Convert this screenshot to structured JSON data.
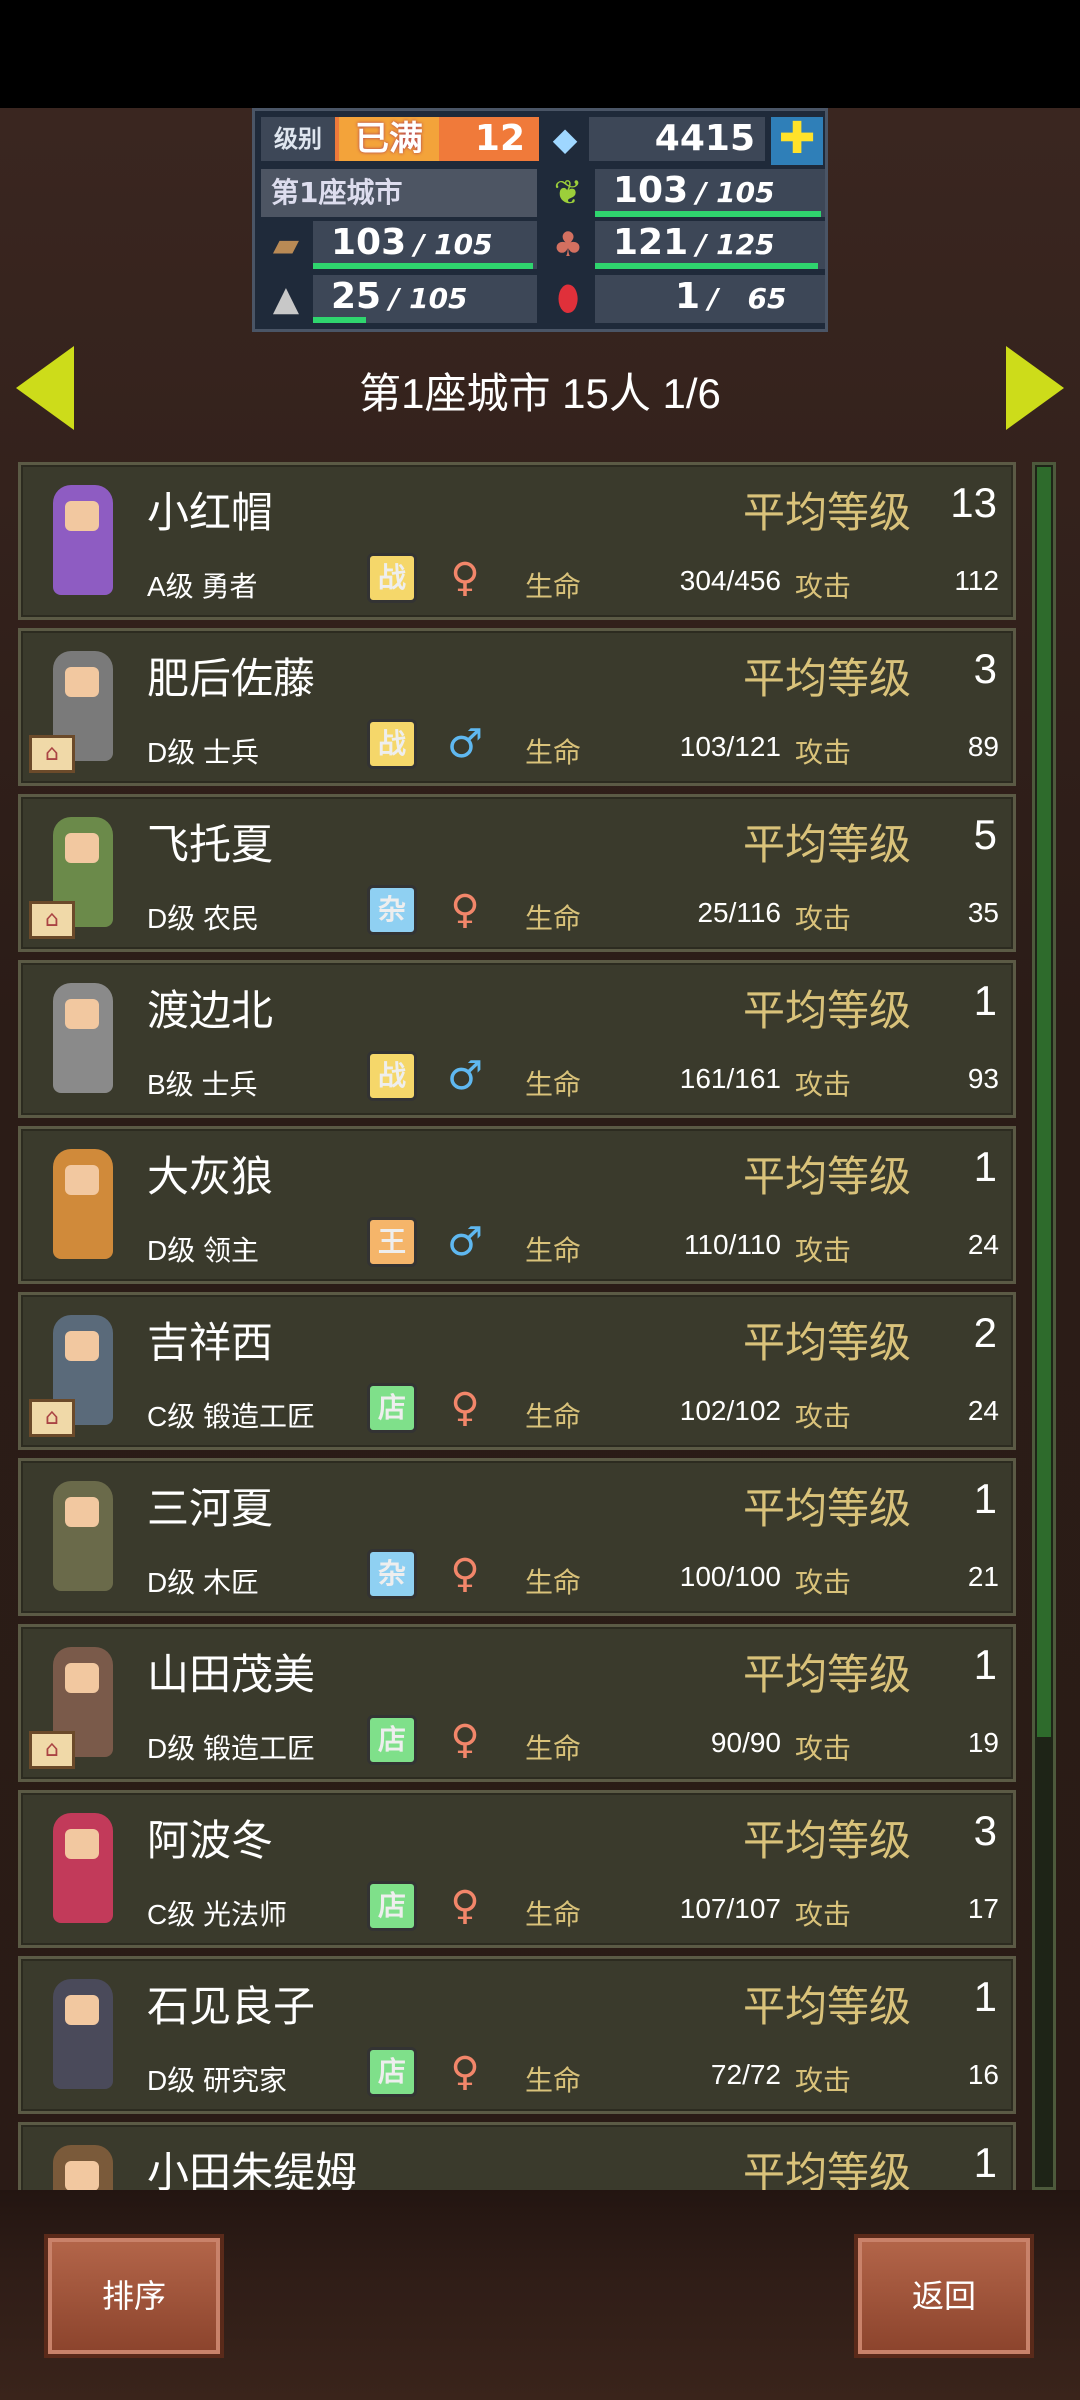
{
  "resources": {
    "level_label": "级别",
    "max_label": "已满",
    "level": "12",
    "gems": "4415",
    "plus_icon": "plus-icon",
    "city_name": "第1座城市",
    "food_current": "103",
    "food_max": "105",
    "wood_current": "103",
    "wood_max": "105",
    "supplies_current": "121",
    "supplies_max": "125",
    "ore_current": "25",
    "ore_max": "105",
    "ruby_current": "1",
    "ruby_max": "65",
    "slash": "/",
    "bars": {
      "food": 0.981,
      "wood": 0.981,
      "supplies": 0.968,
      "ore": 0.238
    }
  },
  "header": {
    "title": "第1座城市  15人 1/6"
  },
  "labels": {
    "avg_level": "平均等级",
    "hp": "生命",
    "attack": "攻击"
  },
  "residents": [
    {
      "name": "小红帽",
      "avg_level": "13",
      "class": "A级 勇者",
      "job": "战",
      "job_color": "#f5d76a",
      "sex": "♀",
      "sex_color": "#f2866a",
      "hp": "304/456",
      "attack": "112",
      "body_color": "#8e5cc2",
      "house": false
    },
    {
      "name": "肥后佐藤",
      "avg_level": "3",
      "class": "D级 士兵",
      "job": "战",
      "job_color": "#f5d76a",
      "sex": "♂",
      "sex_color": "#5fb8f0",
      "hp": "103/121",
      "attack": "89",
      "body_color": "#7a7a7a",
      "house": true
    },
    {
      "name": "飞托夏",
      "avg_level": "5",
      "class": "D级 农民",
      "job": "杂",
      "job_color": "#8fd0f2",
      "sex": "♀",
      "sex_color": "#f2866a",
      "hp": "25/116",
      "attack": "35",
      "body_color": "#6b8a4a",
      "house": true
    },
    {
      "name": "渡边北",
      "avg_level": "1",
      "class": "B级 士兵",
      "job": "战",
      "job_color": "#f5d76a",
      "sex": "♂",
      "sex_color": "#5fb8f0",
      "hp": "161/161",
      "attack": "93",
      "body_color": "#8a8a8a",
      "house": false
    },
    {
      "name": "大灰狼",
      "avg_level": "1",
      "class": "D级 领主",
      "job": "王",
      "job_color": "#f5b56a",
      "sex": "♂",
      "sex_color": "#5fb8f0",
      "hp": "110/110",
      "attack": "24",
      "body_color": "#d08a3a",
      "house": false
    },
    {
      "name": "吉祥西",
      "avg_level": "2",
      "class": "C级 锻造工匠",
      "job": "店",
      "job_color": "#7fe08a",
      "sex": "♀",
      "sex_color": "#f2866a",
      "hp": "102/102",
      "attack": "24",
      "body_color": "#5a6a7a",
      "house": true
    },
    {
      "name": "三河夏",
      "avg_level": "1",
      "class": "D级 木匠",
      "job": "杂",
      "job_color": "#8fd0f2",
      "sex": "♀",
      "sex_color": "#f2866a",
      "hp": "100/100",
      "attack": "21",
      "body_color": "#6a6a4a",
      "house": false
    },
    {
      "name": "山田茂美",
      "avg_level": "1",
      "class": "D级 锻造工匠",
      "job": "店",
      "job_color": "#7fe08a",
      "sex": "♀",
      "sex_color": "#f2866a",
      "hp": "90/90",
      "attack": "19",
      "body_color": "#7a5a4a",
      "house": true
    },
    {
      "name": "阿波冬",
      "avg_level": "3",
      "class": "C级 光法师",
      "job": "店",
      "job_color": "#7fe08a",
      "sex": "♀",
      "sex_color": "#f2866a",
      "hp": "107/107",
      "attack": "17",
      "body_color": "#c23a5a",
      "house": false
    },
    {
      "name": "石见良子",
      "avg_level": "1",
      "class": "D级 研究家",
      "job": "店",
      "job_color": "#7fe08a",
      "sex": "♀",
      "sex_color": "#f2866a",
      "hp": "72/72",
      "attack": "16",
      "body_color": "#4a4a5a",
      "house": false
    },
    {
      "name": "小田朱缇姆",
      "avg_level": "1",
      "class": "",
      "job": "",
      "job_color": "#7fe08a",
      "sex": "",
      "sex_color": "#f2866a",
      "hp": "",
      "attack": "",
      "body_color": "#7a5a3a",
      "house": false
    }
  ],
  "buttons": {
    "sort": "排序",
    "back": "返回"
  }
}
